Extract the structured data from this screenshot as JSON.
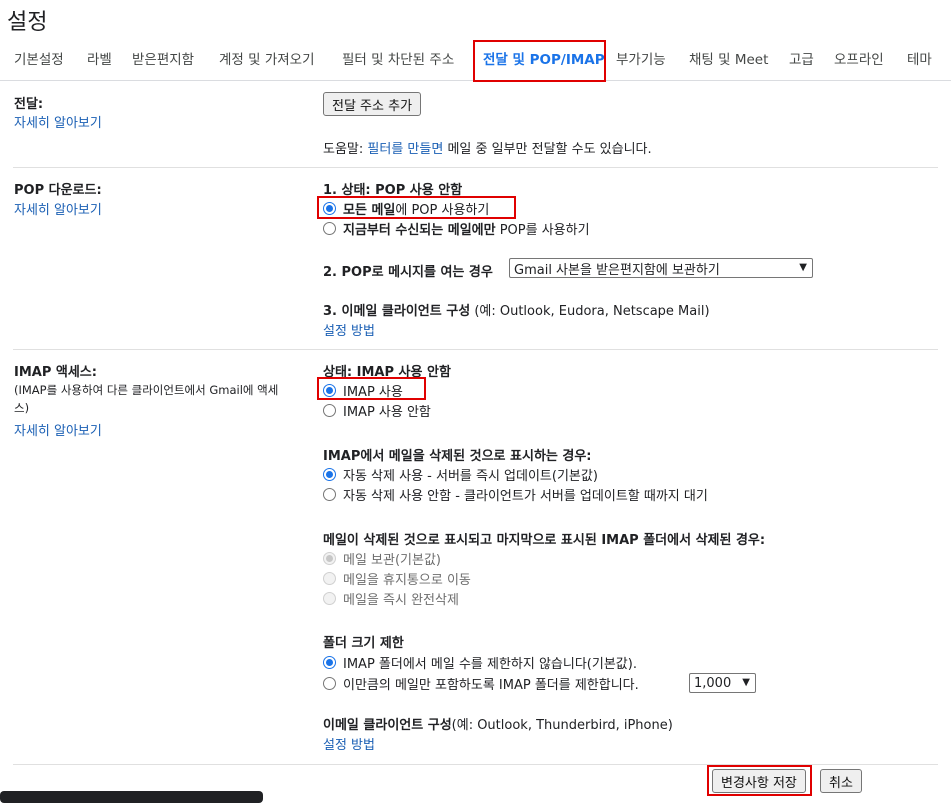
{
  "page": {
    "title": "설정"
  },
  "tabs": [
    {
      "label": "기본설정"
    },
    {
      "label": "라벨"
    },
    {
      "label": "받은편지함"
    },
    {
      "label": "계정 및 가져오기"
    },
    {
      "label": "필터 및 차단된 주소"
    },
    {
      "label": "전달 및 POP/IMAP",
      "active": true
    },
    {
      "label": "부가기능"
    },
    {
      "label": "채팅 및 Meet"
    },
    {
      "label": "고급"
    },
    {
      "label": "오프라인"
    },
    {
      "label": "테마"
    }
  ],
  "forwarding": {
    "label": "전달:",
    "learn_more": "자세히 알아보기",
    "add_button": "전달 주소 추가",
    "tip_prefix": "도움말:",
    "tip_link": "필터를 만들면",
    "tip_suffix": "메일 중 일부만 전달할 수도 있습니다."
  },
  "pop": {
    "label": "POP 다운로드:",
    "learn_more": "자세히 알아보기",
    "status_heading": "1. 상태: POP 사용 안함",
    "opt_all_bold": "모든 메일",
    "opt_all_rest": "에 POP 사용하기",
    "opt_new_bold": "지금부터 수신되는 메일에만",
    "opt_new_rest": "POP를 사용하기",
    "when_heading": "2. POP로 메시지를 여는 경우",
    "when_select": "Gmail 사본을 받은편지함에 보관하기",
    "client_heading": "3. 이메일 클라이언트 구성",
    "client_hint": "(예: Outlook, Eudora, Netscape Mail)",
    "setup_link": "설정 방법"
  },
  "imap": {
    "label": "IMAP 액세스:",
    "desc_line1": "(IMAP를 사용하여 다른 클라이언트에서 Gmail에 액세",
    "desc_line2": "스)",
    "learn_more": "자세히 알아보기",
    "status_heading": "상태: IMAP 사용 안함",
    "opt_enable": "IMAP 사용",
    "opt_disable": "IMAP 사용 안함",
    "delete_heading": "IMAP에서 메일을 삭제된 것으로 표시하는 경우:",
    "delete_opt_auto": "자동 삭제 사용 - 서버를 즉시 업데이트(기본값)",
    "delete_opt_manual": "자동 삭제 사용 안함 - 클라이언트가 서버를 업데이트할 때까지 대기",
    "expunge_heading": "메일이 삭제된 것으로 표시되고 마지막으로 표시된 IMAP 폴더에서 삭제된 경우:",
    "expunge_opt_archive": "메일 보관(기본값)",
    "expunge_opt_trash": "메일을 휴지통으로 이동",
    "expunge_opt_delete": "메일을 즉시 완전삭제",
    "folder_heading": "폴더 크기 제한",
    "folder_opt_unlimited": "IMAP 폴더에서 메일 수를 제한하지 않습니다(기본값).",
    "folder_opt_limit": "이만큼의 메일만 포함하도록 IMAP 폴더를 제한합니다.",
    "folder_limit_value": "1,000",
    "client_heading": "이메일 클라이언트 구성",
    "client_hint": "(예: Outlook, Thunderbird, iPhone)",
    "setup_link": "설정 방법"
  },
  "footer": {
    "save_button": "변경사항 저장",
    "cancel_button": "취소"
  },
  "colors": {
    "accent": "#1a73e8",
    "link": "#1a5fb4",
    "highlight": "#e00000"
  }
}
